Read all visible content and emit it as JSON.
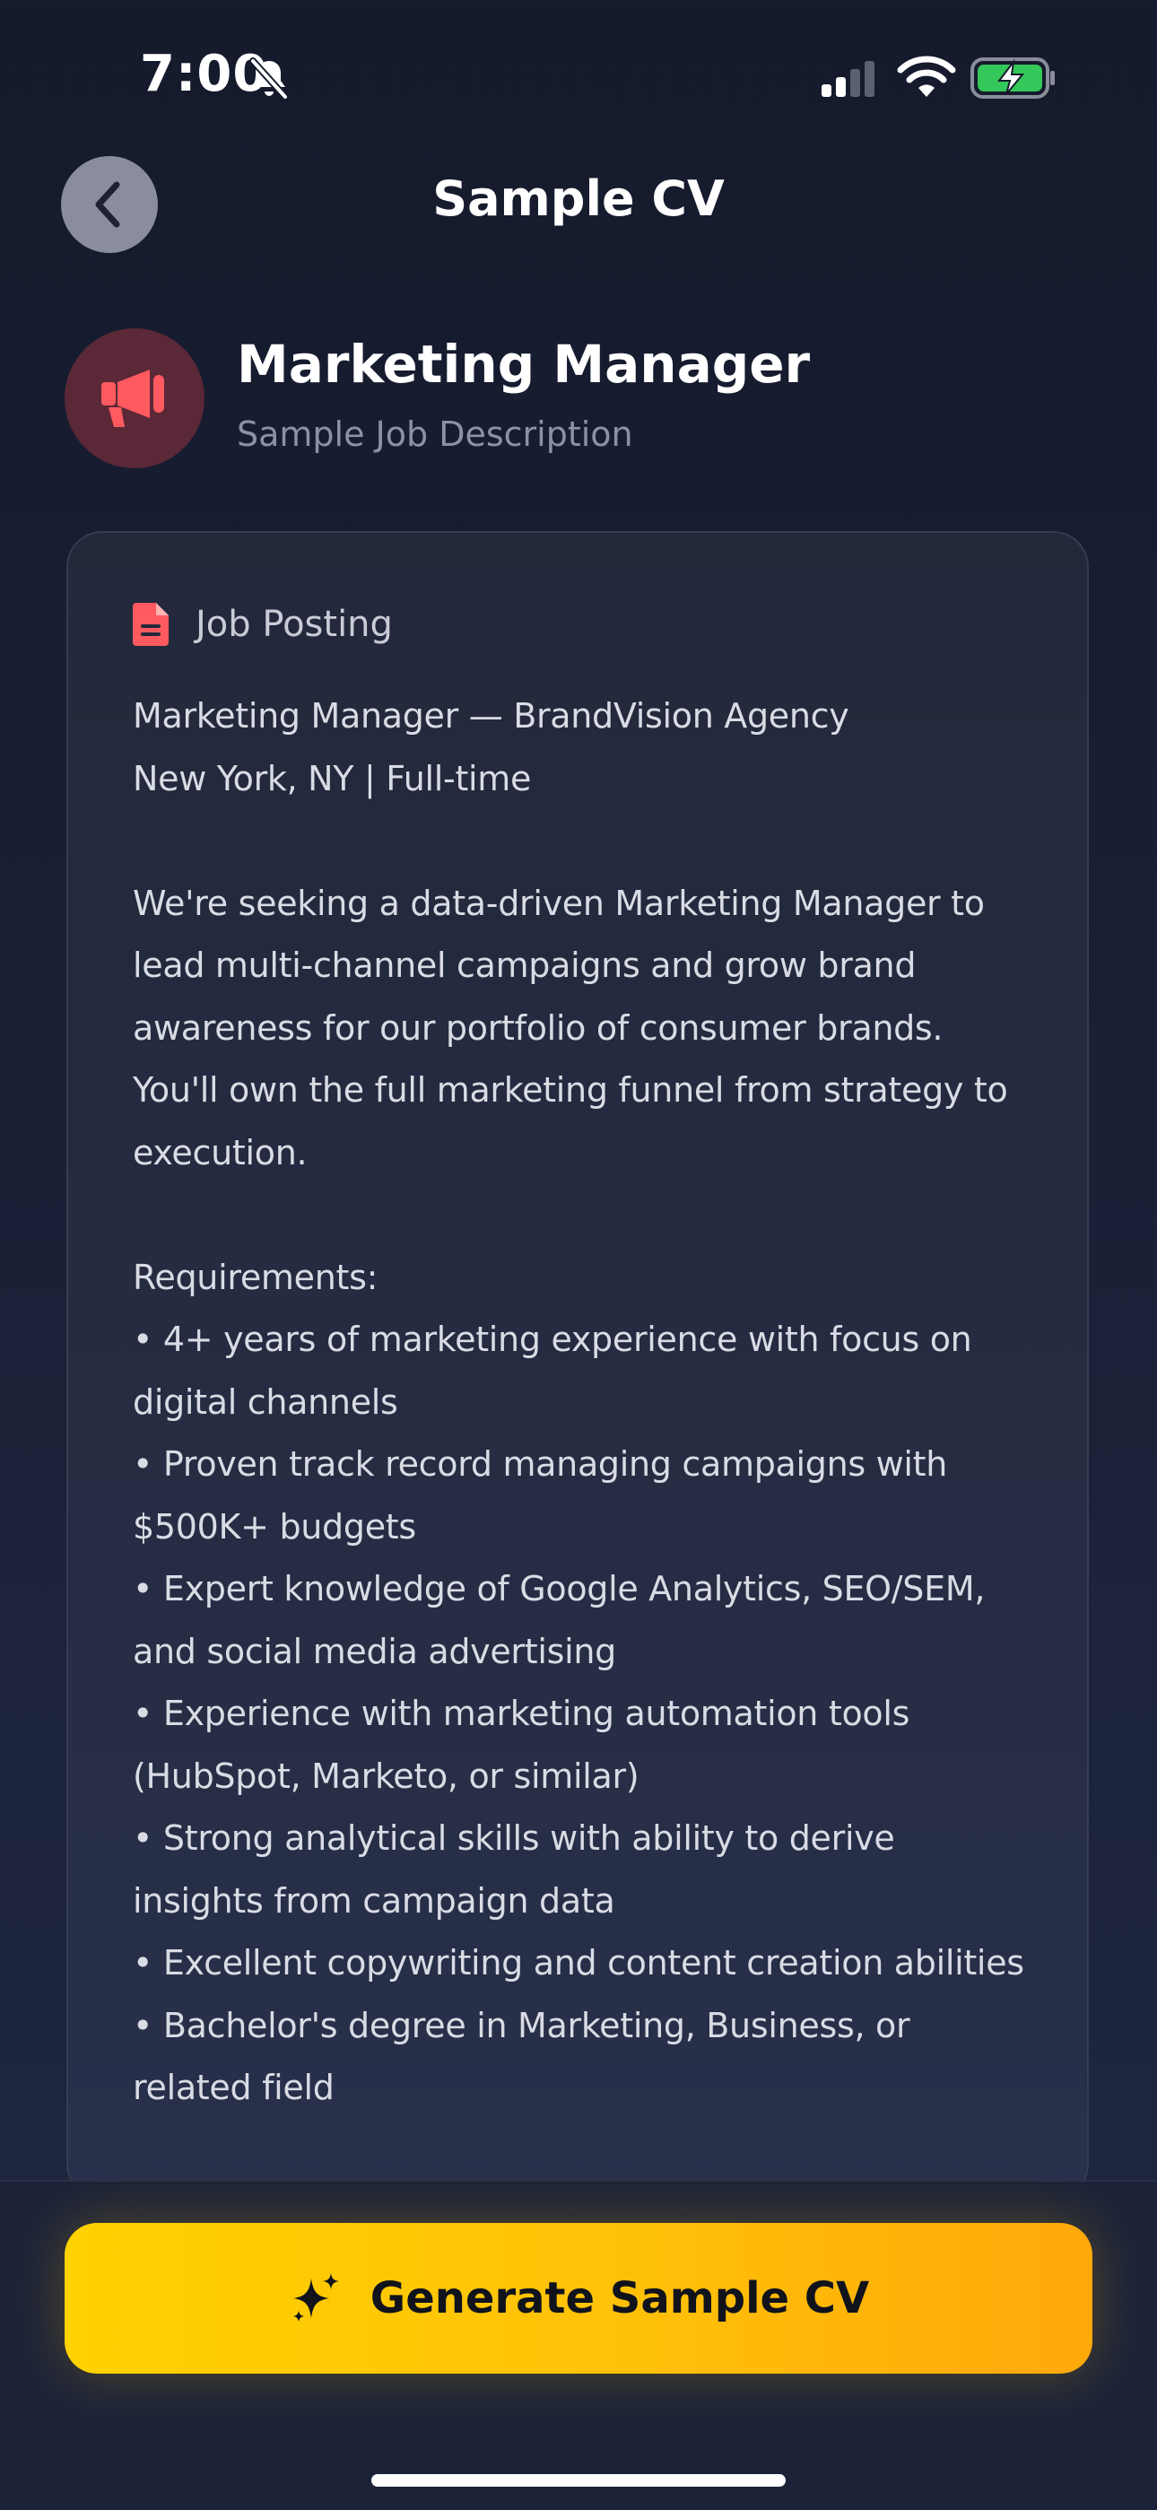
{
  "status_bar": {
    "time": "7:00",
    "icons": [
      "bell-slash-icon",
      "cellular-signal-icon",
      "wifi-icon",
      "battery-charging-icon"
    ]
  },
  "header": {
    "title": "Sample CV",
    "back_icon": "chevron-left-icon"
  },
  "job": {
    "icon": "megaphone-icon",
    "title": "Marketing Manager",
    "subtitle": "Sample Job Description"
  },
  "card": {
    "icon": "document-icon",
    "label": "Job Posting",
    "text": "Marketing Manager — BrandVision Agency\nNew York, NY | Full-time\n\nWe're seeking a data-driven Marketing Manager to\nlead multi-channel campaigns and grow brand\nawareness for our portfolio of consumer brands.\nYou'll own the full marketing funnel from strategy to\nexecution.\n\nRequirements:\n• 4+ years of marketing experience with focus on\ndigital channels\n• Proven track record managing campaigns with\n$500K+ budgets\n• Expert knowledge of Google Analytics, SEO/SEM,\nand social media advertising\n• Experience with marketing automation tools\n(HubSpot, Marketo, or similar)\n• Strong analytical skills with ability to derive\ninsights from campaign data\n• Excellent copywriting and content creation abilities\n• Bachelor's degree in Marketing, Business, or\nrelated field"
  },
  "action": {
    "icon": "sparkles-icon",
    "label": "Generate Sample CV"
  },
  "colors": {
    "background": "#1a2036",
    "accent_icon": "#ff5a5f",
    "button_start": "#ffd200",
    "button_end": "#ffa80a"
  }
}
